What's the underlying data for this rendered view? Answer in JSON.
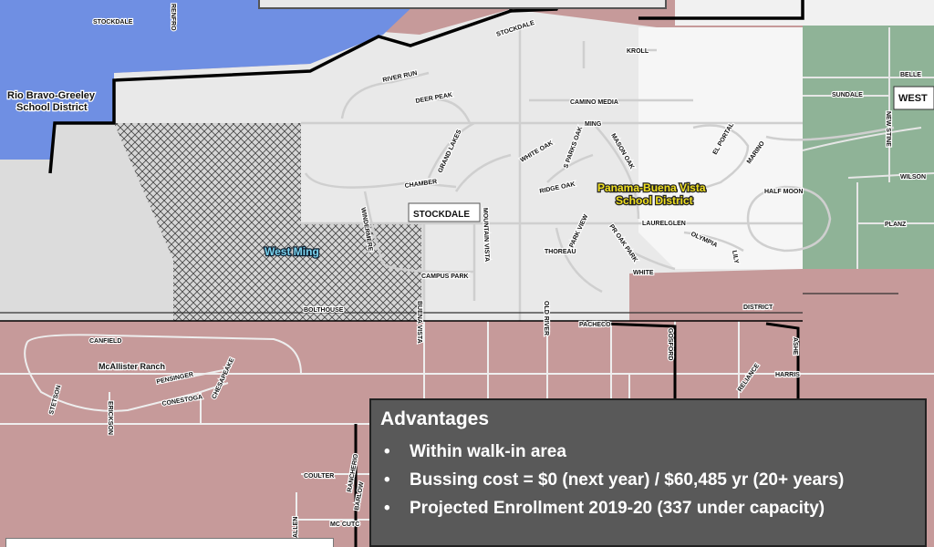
{
  "map": {
    "areas": {
      "rio_bravo": "Rio Bravo-Greeley School District",
      "rio_bravo_lines": [
        "Rio Bravo-Greeley",
        "School District"
      ],
      "panama_lines": [
        "Panama-Buena Vista",
        "School District"
      ],
      "west_ming": "West Ming",
      "mcallister": "McAllister Ranch",
      "stockdale_box": "STOCKDALE",
      "west_box": "WEST"
    },
    "roads": {
      "stockdale": "STOCKDALE",
      "renfro": "RENFRO",
      "river_run": "RIVER RUN",
      "deer_peak": "DEER PEAK",
      "kroll": "KROLL",
      "camino_media": "CAMINO MEDIA",
      "ming": "MING",
      "grand_lakes": "GRAND LAKES",
      "white_oak": "WHITE OAK",
      "sparks_oak": "S PARKS OAK",
      "mason_oak": "MASON OAK",
      "el_portal": "EL PORTAL",
      "marino": "MARINO",
      "chamber": "CHAMBER",
      "ridge_oak": "RIDGE OAK",
      "half_moon": "HALF MOON",
      "laurelglen": "LAURELGLEN",
      "windermere": "WINDERMERE",
      "mountain_vista": "MOUNTAIN VISTA",
      "thoreau": "THOREAU",
      "park_view": "PARK VIEW",
      "prospect_oak": "PR OAK PARK",
      "olympia": "OLYMPIA",
      "lily": "LILY",
      "white": "WHITE",
      "campus_park": "CAMPUS PARK",
      "bolthouse": "BOLTHOUSE",
      "buena_vista": "BUENA VISTA",
      "old_river": "OLD RIVER",
      "pacheco": "PACHECO",
      "district": "DISTRICT",
      "gosford": "GOSFORD",
      "ashe": "ASHE",
      "harris": "HARRIS",
      "reliance": "RELIANCE",
      "canfield": "CANFIELD",
      "pensinger": "PENSINGER",
      "conestoga": "CONESTOGA",
      "chesapeake": "CHESAPEAKE",
      "stetson": "STETSON",
      "erickson": "ERICKSON",
      "coulter": "COULTER",
      "rancherio": "RANCHERIO",
      "barlow": "BARLOW",
      "mc_cutcheon": "MC CUTC",
      "allen": "ALLEN",
      "belle": "BELLE",
      "sundale": "SUNDALE",
      "new_stine": "NEW STINE",
      "wilson": "WILSON",
      "planz": "PLANZ"
    },
    "colors": {
      "rio_bravo_blue": "#6f8fe3",
      "panama_light": "#ececec",
      "residential_pink": "#c69a9a",
      "greenfield_green": "#8fb397",
      "west_ming_hatch": "#cfcfcf",
      "boundary_black": "#000000"
    }
  },
  "advantages": {
    "title": "Advantages",
    "bullet": "•",
    "items": [
      "Within walk-in area",
      "Bussing cost = $0 (next year) / $60,485 yr (20+ years)",
      "Projected Enrollment 2019-20 (337 under capacity)"
    ]
  }
}
